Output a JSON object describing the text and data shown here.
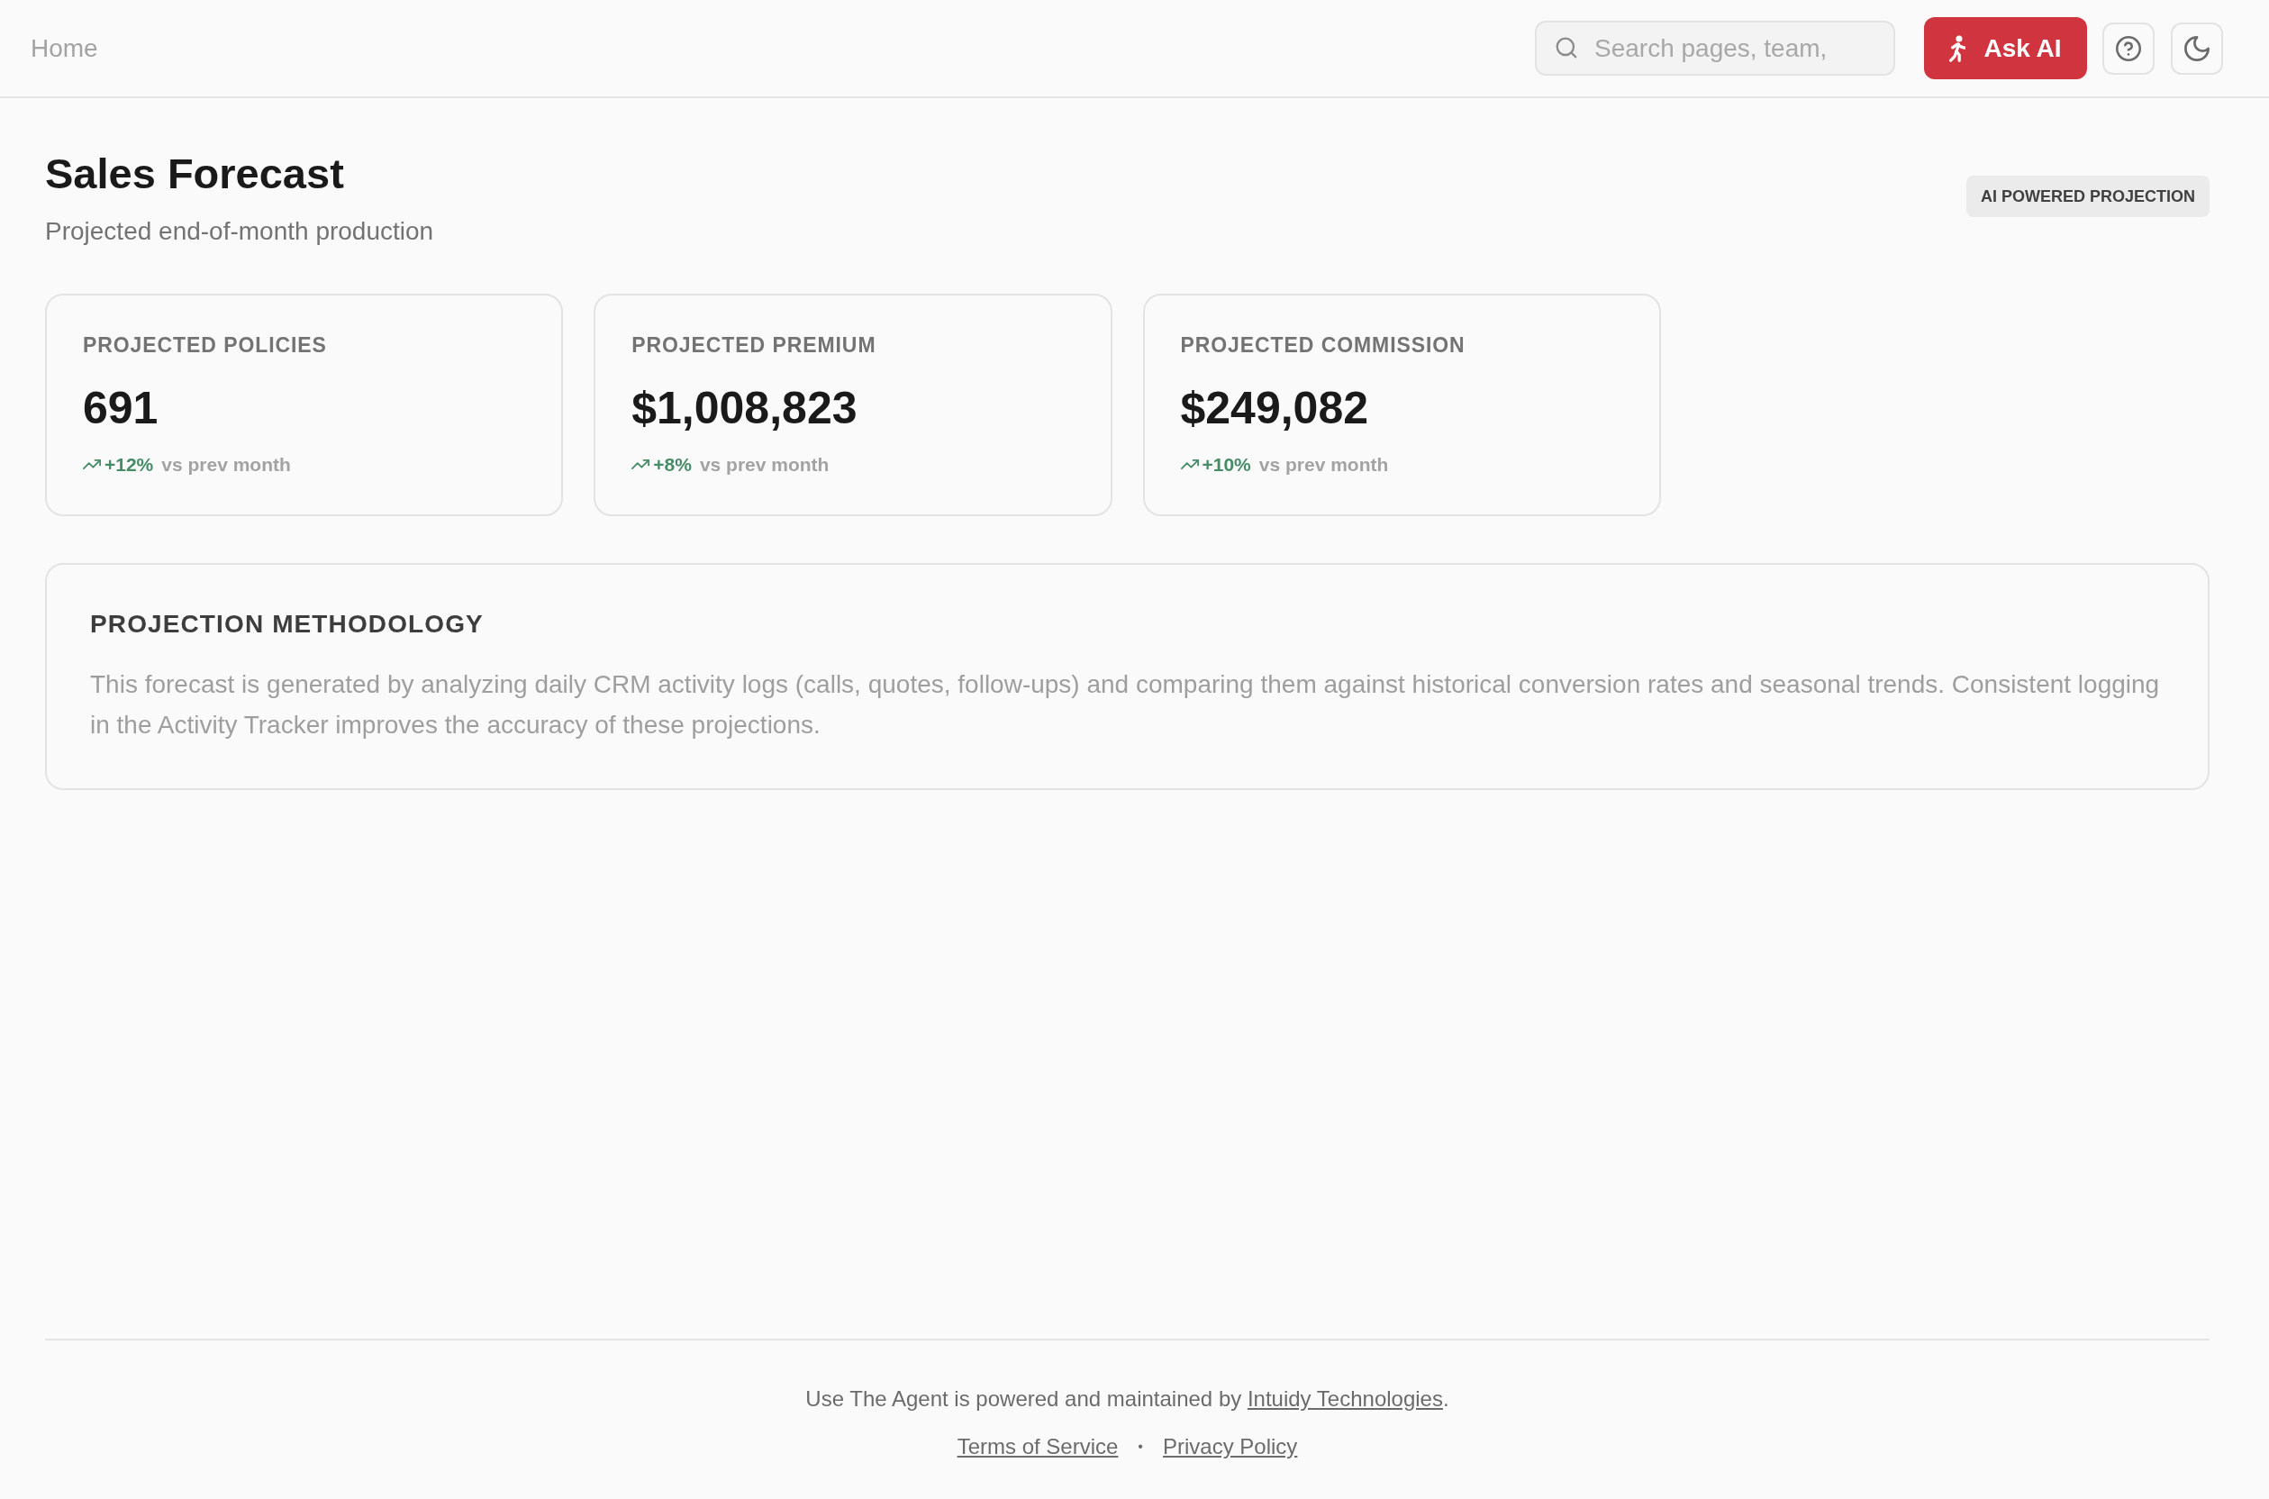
{
  "top_bar": {
    "breadcrumb": "Home",
    "search": {
      "placeholder": "Search pages, team,"
    },
    "ask_ai_button": {
      "label": "Ask AI"
    }
  },
  "header": {
    "title": "Sales Forecast",
    "subtitle": "Projected end-of-month production",
    "badge": "AI POWERED PROJECTION"
  },
  "metrics": [
    {
      "label": "PROJECTED POLICIES",
      "value": "691",
      "rising": true,
      "change": "+12%",
      "comparison": "vs prev month"
    },
    {
      "label": "PROJECTED PREMIUM",
      "value": "$1,008,823",
      "rising": true,
      "change": "+8%",
      "comparison": "vs prev month"
    },
    {
      "label": "PROJECTED COMMISSION",
      "value": "$249,082",
      "rising": true,
      "change": "+10%",
      "comparison": "vs prev month"
    }
  ],
  "methodology": {
    "title": "PROJECTION METHODOLOGY",
    "text": "This forecast is generated by analyzing daily CRM activity logs (calls, quotes, follow-ups) and comparing them against historical conversion rates and seasonal trends. Consistent logging in the Activity Tracker improves the accuracy of these projections."
  },
  "footer": {
    "credit": {
      "text": "Use The Agent is powered and maintained by",
      "link": "Intuidy Technologies",
      "end": "."
    },
    "links": [
      "Terms of Service",
      "Privacy Policy"
    ],
    "separator": "•"
  }
}
